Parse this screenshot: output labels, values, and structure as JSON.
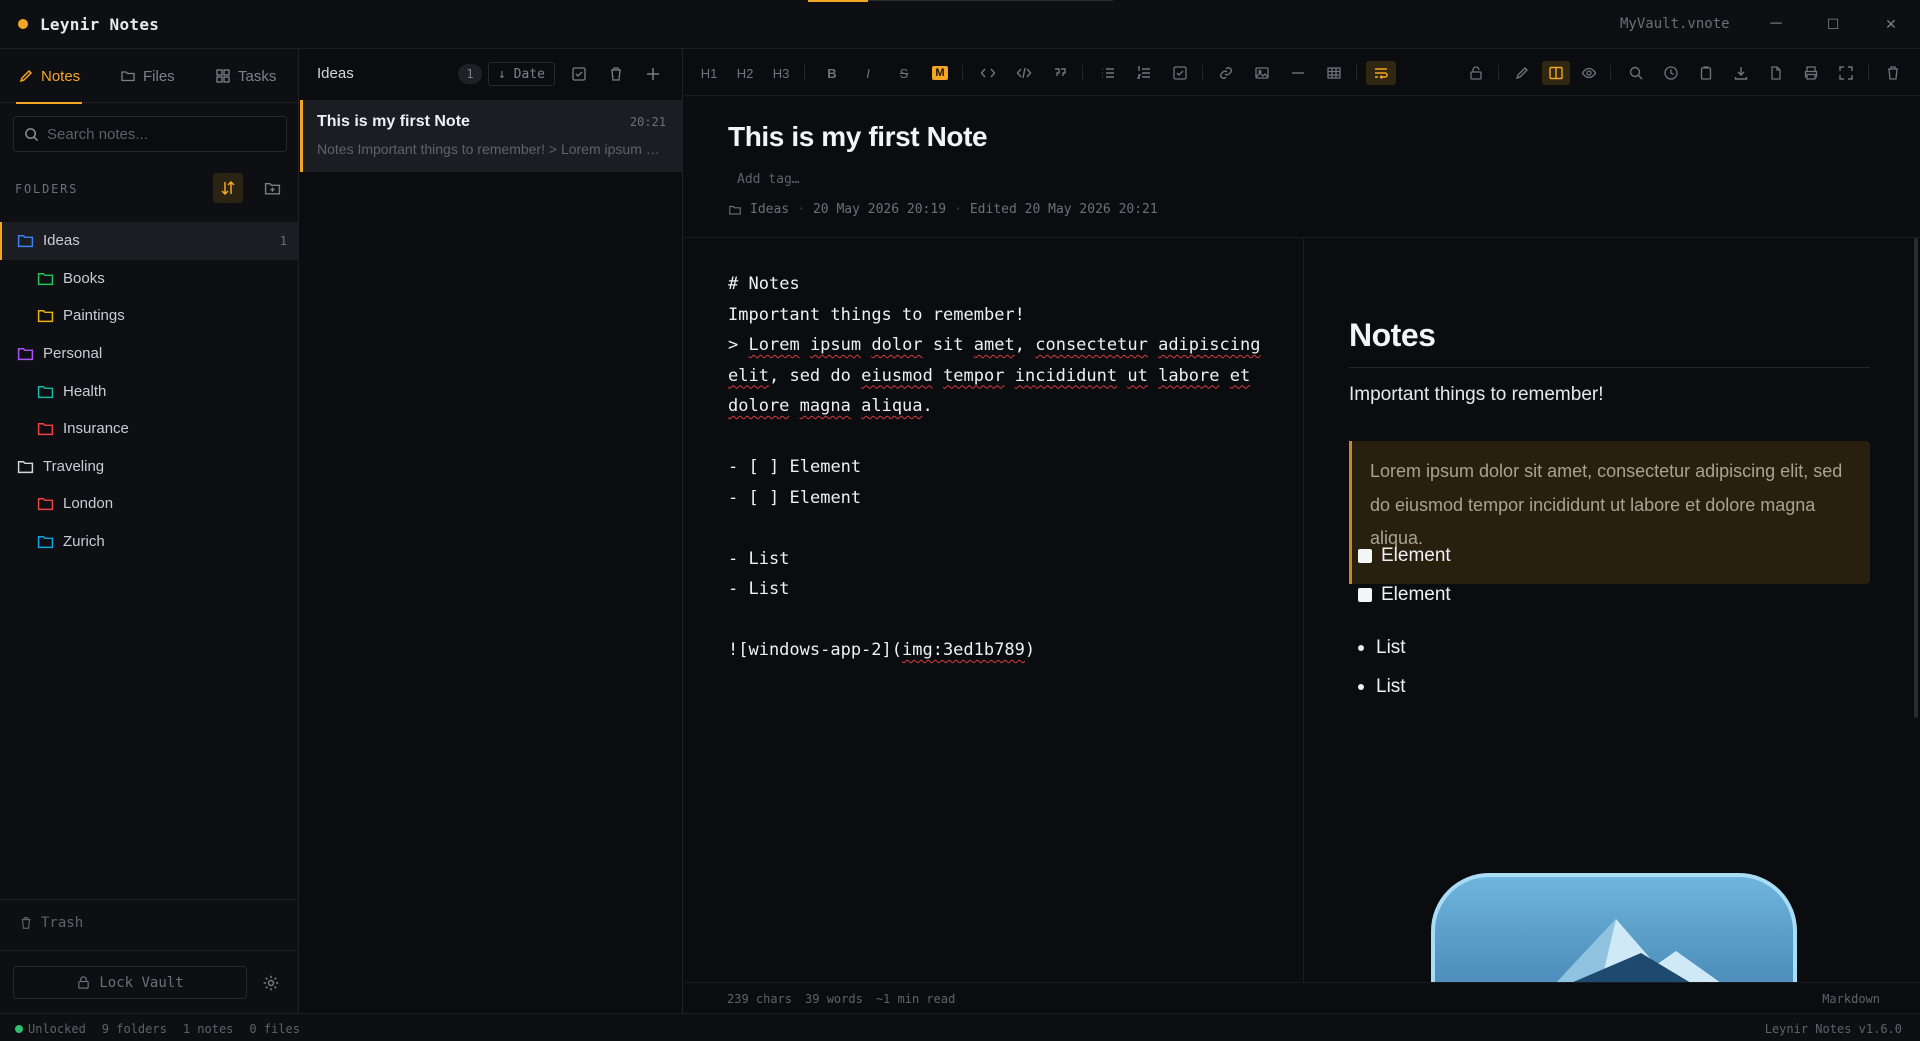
{
  "window": {
    "app_title": "Leynir Notes",
    "vault_name": "MyVault.vnote",
    "minimize": "─",
    "maximize": "☐",
    "close": "✕"
  },
  "sidebar": {
    "tabs": [
      {
        "label": "Notes",
        "icon": "pencil-icon",
        "active": true
      },
      {
        "label": "Files",
        "icon": "folder-icon"
      },
      {
        "label": "Tasks",
        "icon": "grid-icon"
      }
    ],
    "search_placeholder": "Search notes...",
    "folders_label": "FOLDERS",
    "folders": [
      {
        "name": "Ideas",
        "color": "#3b82f6",
        "indent": 0,
        "count": "1",
        "active": true
      },
      {
        "name": "Books",
        "color": "#22c55e",
        "indent": 1,
        "count": ""
      },
      {
        "name": "Paintings",
        "color": "#eab308",
        "indent": 1,
        "count": ""
      },
      {
        "name": "Personal",
        "color": "#a855f7",
        "indent": 0,
        "count": ""
      },
      {
        "name": "Health",
        "color": "#14b8a6",
        "indent": 1,
        "count": ""
      },
      {
        "name": "Insurance",
        "color": "#ef4444",
        "indent": 1,
        "count": ""
      },
      {
        "name": "Traveling",
        "color": "#d4d7de",
        "indent": 0,
        "count": ""
      },
      {
        "name": "London",
        "color": "#ef4444",
        "indent": 1,
        "count": ""
      },
      {
        "name": "Zurich",
        "color": "#0ea5e9",
        "indent": 1,
        "count": ""
      }
    ],
    "trash_label": "Trash",
    "lock_label": "Lock Vault"
  },
  "notelist": {
    "title": "Ideas",
    "count": "1",
    "sort_label": "↓ Date",
    "notes": [
      {
        "title": "This is my first Note",
        "time": "20:21",
        "preview": "Notes Important things to remember! > Lorem ipsum dolor sit amet"
      }
    ]
  },
  "editor": {
    "toolbar": {
      "h1": "H1",
      "h2": "H2",
      "h3": "H3",
      "bold": "B",
      "italic": "I",
      "strike": "S",
      "mark": "M"
    },
    "title": "This is my first Note",
    "tag_placeholder": "Add tag…",
    "meta": {
      "folder": "Ideas",
      "created": "20 May 2026 20:19",
      "edited": "Edited 20 May 2026 20:21"
    },
    "source_lines": [
      "# Notes",
      "Important things to remember!",
      "> Lorem ipsum dolor sit amet, consectetur adipiscing",
      "elit, sed do eiusmod tempor incididunt ut labore et",
      "dolore magna aliqua.",
      "",
      "- [ ] Element",
      "- [ ] Element",
      "",
      "- List",
      "- List",
      "",
      "![windows-app-2](img:3ed1b789)"
    ],
    "preview": {
      "h1": "Notes",
      "paragraph": "Important things to remember!",
      "quote": "Lorem ipsum dolor sit amet, consectetur adipiscing elit, sed do eiusmod tempor incididunt ut labore et dolore magna aliqua.",
      "checks": [
        "Element",
        "Element"
      ],
      "list": [
        "List",
        "List"
      ]
    },
    "status": {
      "chars": "239 chars",
      "words": "39 words",
      "read": "~1 min read",
      "mode": "Markdown"
    }
  },
  "statusbar": {
    "unlocked": "Unlocked",
    "folders": "9 folders",
    "notes": "1 notes",
    "files": "0 files",
    "version": "Leynir Notes v1.6.0"
  },
  "colors": {
    "accent": "#f5a524",
    "background": "#0b0c0f",
    "success": "#2fbf71"
  }
}
